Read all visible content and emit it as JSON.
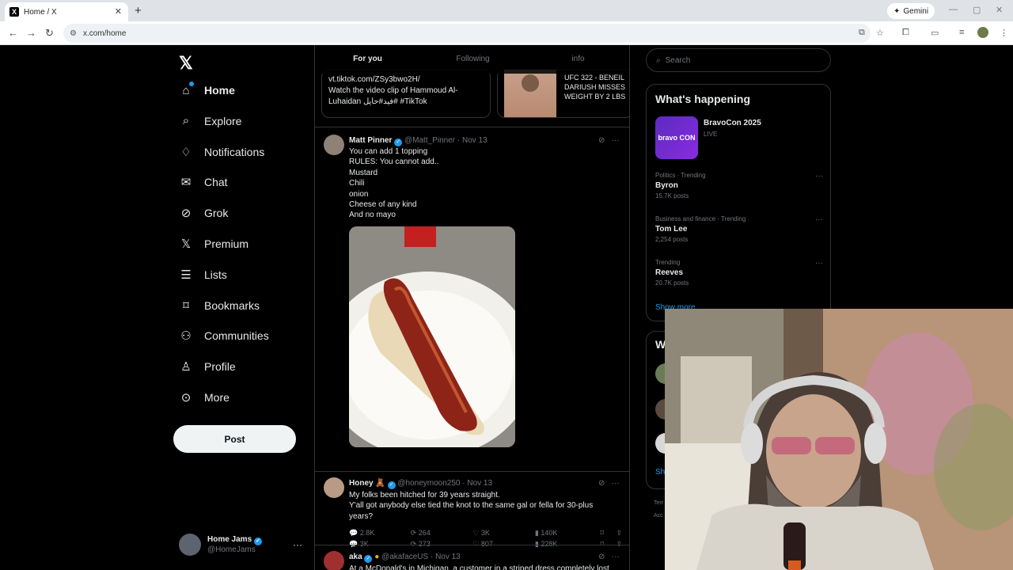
{
  "browser": {
    "tab_title": "Home / X",
    "tab_favicon": "X",
    "new_tab": "+",
    "close_tab": "✕",
    "gemini_label": "Gemini",
    "url": "x.com/home"
  },
  "nav": {
    "items": [
      {
        "label": "Home",
        "icon": "home-icon"
      },
      {
        "label": "Explore",
        "icon": "search-icon"
      },
      {
        "label": "Notifications",
        "icon": "bell-icon"
      },
      {
        "label": "Chat",
        "icon": "mail-icon"
      },
      {
        "label": "Grok",
        "icon": "grok-icon"
      },
      {
        "label": "Premium",
        "icon": "x-icon"
      },
      {
        "label": "Lists",
        "icon": "list-icon"
      },
      {
        "label": "Bookmarks",
        "icon": "bookmark-icon"
      },
      {
        "label": "Communities",
        "icon": "people-icon"
      },
      {
        "label": "Profile",
        "icon": "person-icon"
      },
      {
        "label": "More",
        "icon": "more-circle-icon"
      }
    ],
    "post_button": "Post",
    "account": {
      "name": "Home Jams",
      "handle": "@HomeJams"
    }
  },
  "feed": {
    "tabs": [
      "For you",
      "Following",
      "info"
    ],
    "card1": {
      "line1": "vt.tiktok.com/ZSy3bwo2H/",
      "line2": "Watch the video clip of Hammoud Al-",
      "line3": "Luhaidan فيد#حايل#  #TikTok"
    },
    "card2": {
      "line1": "UFC 322 - BENEIL",
      "line2": "DARIUSH MISSES",
      "line3": "WEIGHT BY 2 LBS"
    },
    "tweets": [
      {
        "name": "Matt Pinner",
        "handle": "@Matt_Pinner",
        "date": "Nov 13",
        "lines": [
          "You can add 1 topping",
          "RULES: You cannot add..",
          "Mustard",
          "Chili",
          "onion",
          "Cheese of any kind",
          "And no mayo"
        ],
        "replies": "3K",
        "reposts": "273",
        "likes": "807",
        "views": "228K"
      },
      {
        "name": "Honey",
        "name_emoji": "🧸",
        "handle": "@honeymoon250",
        "date": "Nov 13",
        "lines": [
          "My folks been hitched for 39 years straight.",
          "Y'all got anybody else tied the knot to the same gal or fella for 30-plus",
          "years?"
        ],
        "replies": "2.8K",
        "reposts": "264",
        "likes": "3K",
        "views": "140K"
      },
      {
        "name": "aka",
        "handle": "@akafaceUS",
        "date": "Nov 13",
        "lines": [
          "At a McDonald's in Michigan, a customer in a striped dress completely lost"
        ]
      }
    ],
    "separator": "·",
    "more_glyph": "···"
  },
  "right": {
    "search_placeholder": "Search",
    "happening_title": "What's happening",
    "bravo": {
      "title": "BravoCon 2025",
      "status": "LIVE",
      "logo": "bravo CON"
    },
    "trends": [
      {
        "context": "Politics · Trending",
        "name": "Byron",
        "posts": "15.7K posts"
      },
      {
        "context": "Business and finance · Trending",
        "name": "Tom Lee",
        "posts": "2,254 posts"
      },
      {
        "context": "Trending",
        "name": "Reeves",
        "posts": "20.7K posts"
      }
    ],
    "show_more": "Show more",
    "who_title": "W",
    "who_show": "Sh",
    "terms_lines": [
      "Terr",
      "Acc"
    ]
  },
  "colors": {
    "accent": "#1d9bf0",
    "bg": "#000000",
    "border": "#2f3336",
    "muted": "#71767b"
  }
}
